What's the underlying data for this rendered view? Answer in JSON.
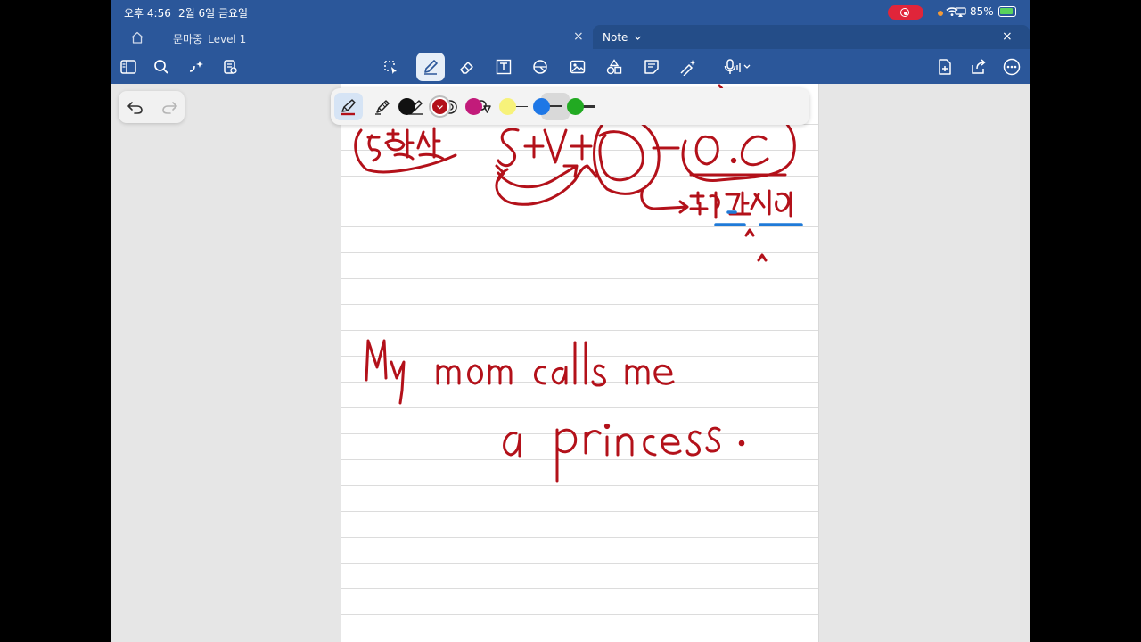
{
  "status": {
    "time": "오후 4:56",
    "date": "2월 6일 금요일",
    "battery": "85%"
  },
  "tabs": {
    "home_icon": "home-icon",
    "level": {
      "label": "문마중_Level 1",
      "close": "×"
    },
    "note": {
      "label": "Note",
      "close": "×"
    }
  },
  "toolbar": {
    "left": [
      "sidebar-icon",
      "search-icon",
      "sparkle-icon",
      "page-list-icon"
    ],
    "center": [
      "lasso-icon",
      "pen-icon",
      "eraser-icon",
      "textbox-icon",
      "shape-icon",
      "image-icon",
      "shapes-icon",
      "sticky-note-icon",
      "laser-pointer-icon",
      "dictate-icon"
    ],
    "right": [
      "add-page-icon",
      "share-icon",
      "more-icon"
    ]
  },
  "pen_tools": {
    "tools": [
      "pen-icon",
      "highlighter-icon",
      "pencil-icon",
      "ink-to-shape-icon",
      "ink-to-text-icon"
    ],
    "stroke_widths": [
      "thin",
      "medium",
      "thick"
    ],
    "selected_stroke": "medium",
    "colors": [
      "#111111",
      "#b3111a",
      "#c21b7a",
      "#f7f27a",
      "#1e77e6",
      "#22aa22"
    ],
    "selected_color": "#b3111a"
  },
  "ink": {
    "color": "#b3111a",
    "highlight_color": "#1f7ad8",
    "handwriting": [
      "My mom calls me",
      "a princess."
    ]
  }
}
